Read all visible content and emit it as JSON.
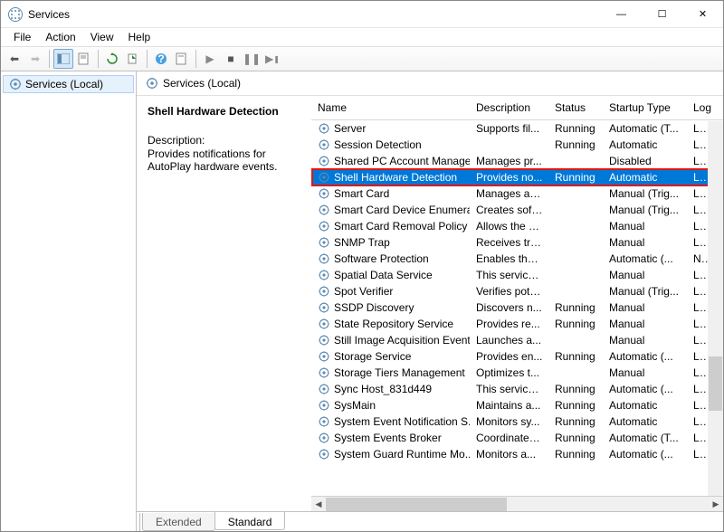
{
  "window": {
    "title": "Services"
  },
  "menu": {
    "file": "File",
    "action": "Action",
    "view": "View",
    "help": "Help"
  },
  "tree": {
    "root_label": "Services (Local)"
  },
  "pane_header": "Services (Local)",
  "details": {
    "title": "Shell Hardware Detection",
    "desc_label": "Description:",
    "desc_text": "Provides notifications for AutoPlay hardware events."
  },
  "columns": {
    "name": "Name",
    "description": "Description",
    "status": "Status",
    "startup": "Startup Type",
    "logon": "Log"
  },
  "tabs": {
    "extended": "Extended",
    "standard": "Standard"
  },
  "selected_index": 3,
  "services": [
    {
      "name": "Server",
      "desc": "Supports fil...",
      "status": "Running",
      "startup": "Automatic (T...",
      "logon": "Loc"
    },
    {
      "name": "Session Detection",
      "desc": "",
      "status": "Running",
      "startup": "Automatic",
      "logon": "Loc"
    },
    {
      "name": "Shared PC Account Manager",
      "desc": "Manages pr...",
      "status": "",
      "startup": "Disabled",
      "logon": "Loc"
    },
    {
      "name": "Shell Hardware Detection",
      "desc": "Provides no...",
      "status": "Running",
      "startup": "Automatic",
      "logon": "Loc"
    },
    {
      "name": "Smart Card",
      "desc": "Manages ac...",
      "status": "",
      "startup": "Manual (Trig...",
      "logon": "Loc"
    },
    {
      "name": "Smart Card Device Enumera...",
      "desc": "Creates soft...",
      "status": "",
      "startup": "Manual (Trig...",
      "logon": "Loc"
    },
    {
      "name": "Smart Card Removal Policy",
      "desc": "Allows the s...",
      "status": "",
      "startup": "Manual",
      "logon": "Loc"
    },
    {
      "name": "SNMP Trap",
      "desc": "Receives tra...",
      "status": "",
      "startup": "Manual",
      "logon": "Loc"
    },
    {
      "name": "Software Protection",
      "desc": "Enables the ...",
      "status": "",
      "startup": "Automatic (...",
      "logon": "Net"
    },
    {
      "name": "Spatial Data Service",
      "desc": "This service ...",
      "status": "",
      "startup": "Manual",
      "logon": "Loc"
    },
    {
      "name": "Spot Verifier",
      "desc": "Verifies pote...",
      "status": "",
      "startup": "Manual (Trig...",
      "logon": "Loc"
    },
    {
      "name": "SSDP Discovery",
      "desc": "Discovers n...",
      "status": "Running",
      "startup": "Manual",
      "logon": "Loc"
    },
    {
      "name": "State Repository Service",
      "desc": "Provides re...",
      "status": "Running",
      "startup": "Manual",
      "logon": "Loc"
    },
    {
      "name": "Still Image Acquisition Events",
      "desc": "Launches a...",
      "status": "",
      "startup": "Manual",
      "logon": "Loc"
    },
    {
      "name": "Storage Service",
      "desc": "Provides en...",
      "status": "Running",
      "startup": "Automatic (...",
      "logon": "Loc"
    },
    {
      "name": "Storage Tiers Management",
      "desc": "Optimizes t...",
      "status": "",
      "startup": "Manual",
      "logon": "Loc"
    },
    {
      "name": "Sync Host_831d449",
      "desc": "This service ...",
      "status": "Running",
      "startup": "Automatic (...",
      "logon": "Loc"
    },
    {
      "name": "SysMain",
      "desc": "Maintains a...",
      "status": "Running",
      "startup": "Automatic",
      "logon": "Loc"
    },
    {
      "name": "System Event Notification S...",
      "desc": "Monitors sy...",
      "status": "Running",
      "startup": "Automatic",
      "logon": "Loc"
    },
    {
      "name": "System Events Broker",
      "desc": "Coordinates...",
      "status": "Running",
      "startup": "Automatic (T...",
      "logon": "Loc"
    },
    {
      "name": "System Guard Runtime Mo...",
      "desc": "Monitors a...",
      "status": "Running",
      "startup": "Automatic (...",
      "logon": "Loc"
    }
  ]
}
